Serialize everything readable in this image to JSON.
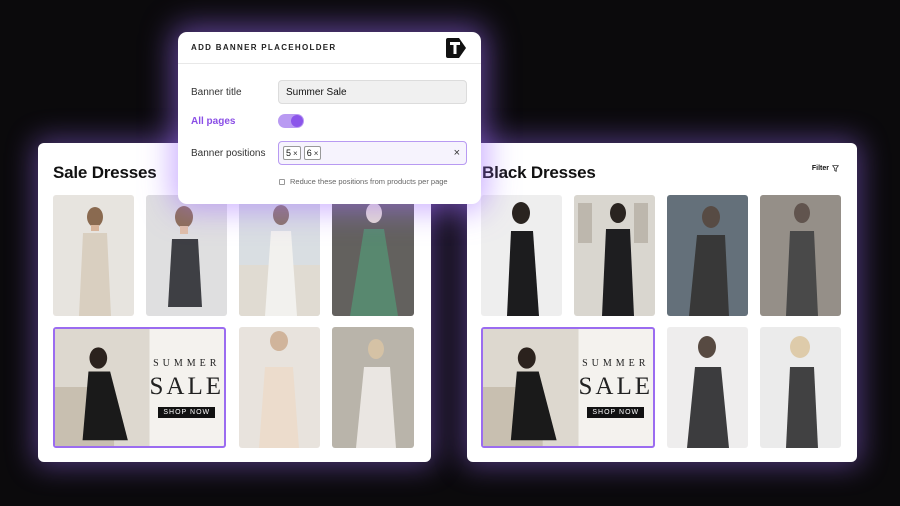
{
  "modal": {
    "title": "ADD BANNER PLACEHOLDER",
    "logo_icon": "brand-t-logo",
    "banner_title_label": "Banner title",
    "banner_title_value": "Summer Sale",
    "all_pages_label": "All pages",
    "all_pages_on": true,
    "positions_label": "Banner positions",
    "positions": [
      {
        "value": "5",
        "remove": "×"
      },
      {
        "value": "6",
        "remove": "×"
      }
    ],
    "clear_label": "×",
    "reduce_label": "Reduce these positions from products per page"
  },
  "left_card": {
    "title": "Sale Dresses",
    "banner": {
      "line1": "SUMMER",
      "line2": "SALE",
      "cta": "SHOP NOW"
    }
  },
  "right_card": {
    "title": "Black Dresses",
    "filter_label": "Filter",
    "filter_icon": "funnel-icon",
    "banner": {
      "line1": "SUMMER",
      "line2": "SALE",
      "cta": "SHOP NOW"
    }
  },
  "colors": {
    "accent": "#8b55ea",
    "accent_light": "#b99af2",
    "glow": "#a06eff",
    "background": "#0b0a0c"
  }
}
